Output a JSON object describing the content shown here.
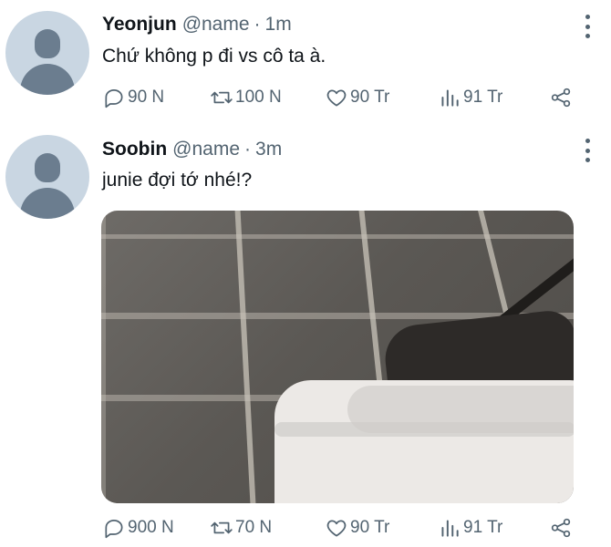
{
  "tweets": [
    {
      "name": "Yeonjun",
      "handle": "@name",
      "separator": "·",
      "time": "1m",
      "text": "Chứ không p đi vs cô ta à.",
      "stats": {
        "replies": "90 N",
        "retweets": "100 N",
        "likes": "90 Tr",
        "views": "91 Tr"
      }
    },
    {
      "name": "Soobin",
      "handle": "@name",
      "separator": "·",
      "time": "3m",
      "text": "junie đợi tớ nhé!?",
      "stats": {
        "replies": "900 N",
        "retweets": "70 N",
        "likes": "90 Tr",
        "views": "91 Tr"
      }
    }
  ],
  "icons": {
    "reply": "comment-icon",
    "retweet": "retweet-icon",
    "like": "heart-icon",
    "views": "views-chart-icon",
    "share": "share-icon",
    "menu": "more-vertical-icon"
  },
  "colors": {
    "text": "#0f1419",
    "muted": "#536471",
    "avatar_bg": "#c9d6e2"
  }
}
